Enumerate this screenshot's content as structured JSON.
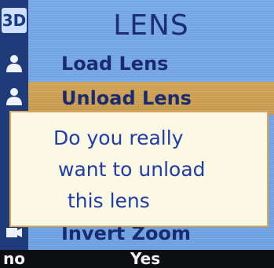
{
  "screen": {
    "title": "LENS",
    "badge": "3D"
  },
  "menu": {
    "items": [
      {
        "label": "Load Lens",
        "icon": "person-icon"
      },
      {
        "label": "Unload Lens",
        "icon": "person-icon",
        "selected": true
      },
      {
        "label": "Invert Zoom",
        "icon": "zoom-icon"
      }
    ]
  },
  "dialog": {
    "lines": [
      "Do you really",
      "want to unload",
      "this lens"
    ]
  },
  "softkeys": {
    "left": "no",
    "center": "Yes"
  },
  "colors": {
    "background": "#6c9fe0",
    "highlight": "#c5984d",
    "dialog_bg": "#fbf8e4",
    "dialog_text": "#1f3ca8",
    "title_text": "#1d2f73"
  }
}
